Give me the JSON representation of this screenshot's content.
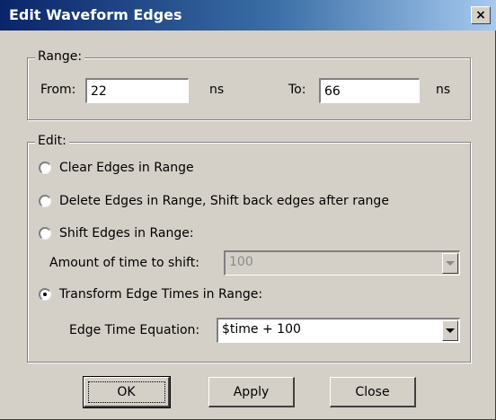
{
  "window": {
    "title": "Edit Waveform Edges",
    "close_symbol": "×"
  },
  "range": {
    "legend": "Range:",
    "from_label": "From:",
    "from_value": "22",
    "from_unit": "ns",
    "to_label": "To:",
    "to_value": "66",
    "to_unit": "ns"
  },
  "edit": {
    "legend": "Edit:",
    "options": [
      {
        "label": "Clear Edges in Range",
        "selected": false
      },
      {
        "label": "Delete Edges in Range, Shift back edges after range",
        "selected": false
      },
      {
        "label": "Shift Edges in Range:",
        "selected": false
      },
      {
        "label": "Transform Edge Times in Range:",
        "selected": true
      }
    ],
    "shift_amount_label": "Amount of time to shift:",
    "shift_amount_value": "100",
    "equation_label": "Edge Time Equation:",
    "equation_value": "$time + 100"
  },
  "buttons": {
    "ok": "OK",
    "apply": "Apply",
    "close": "Close"
  },
  "colors": {
    "dialog_bg": "#d4d0c8",
    "title_start": "#0a246a",
    "title_end": "#a6caf0"
  }
}
